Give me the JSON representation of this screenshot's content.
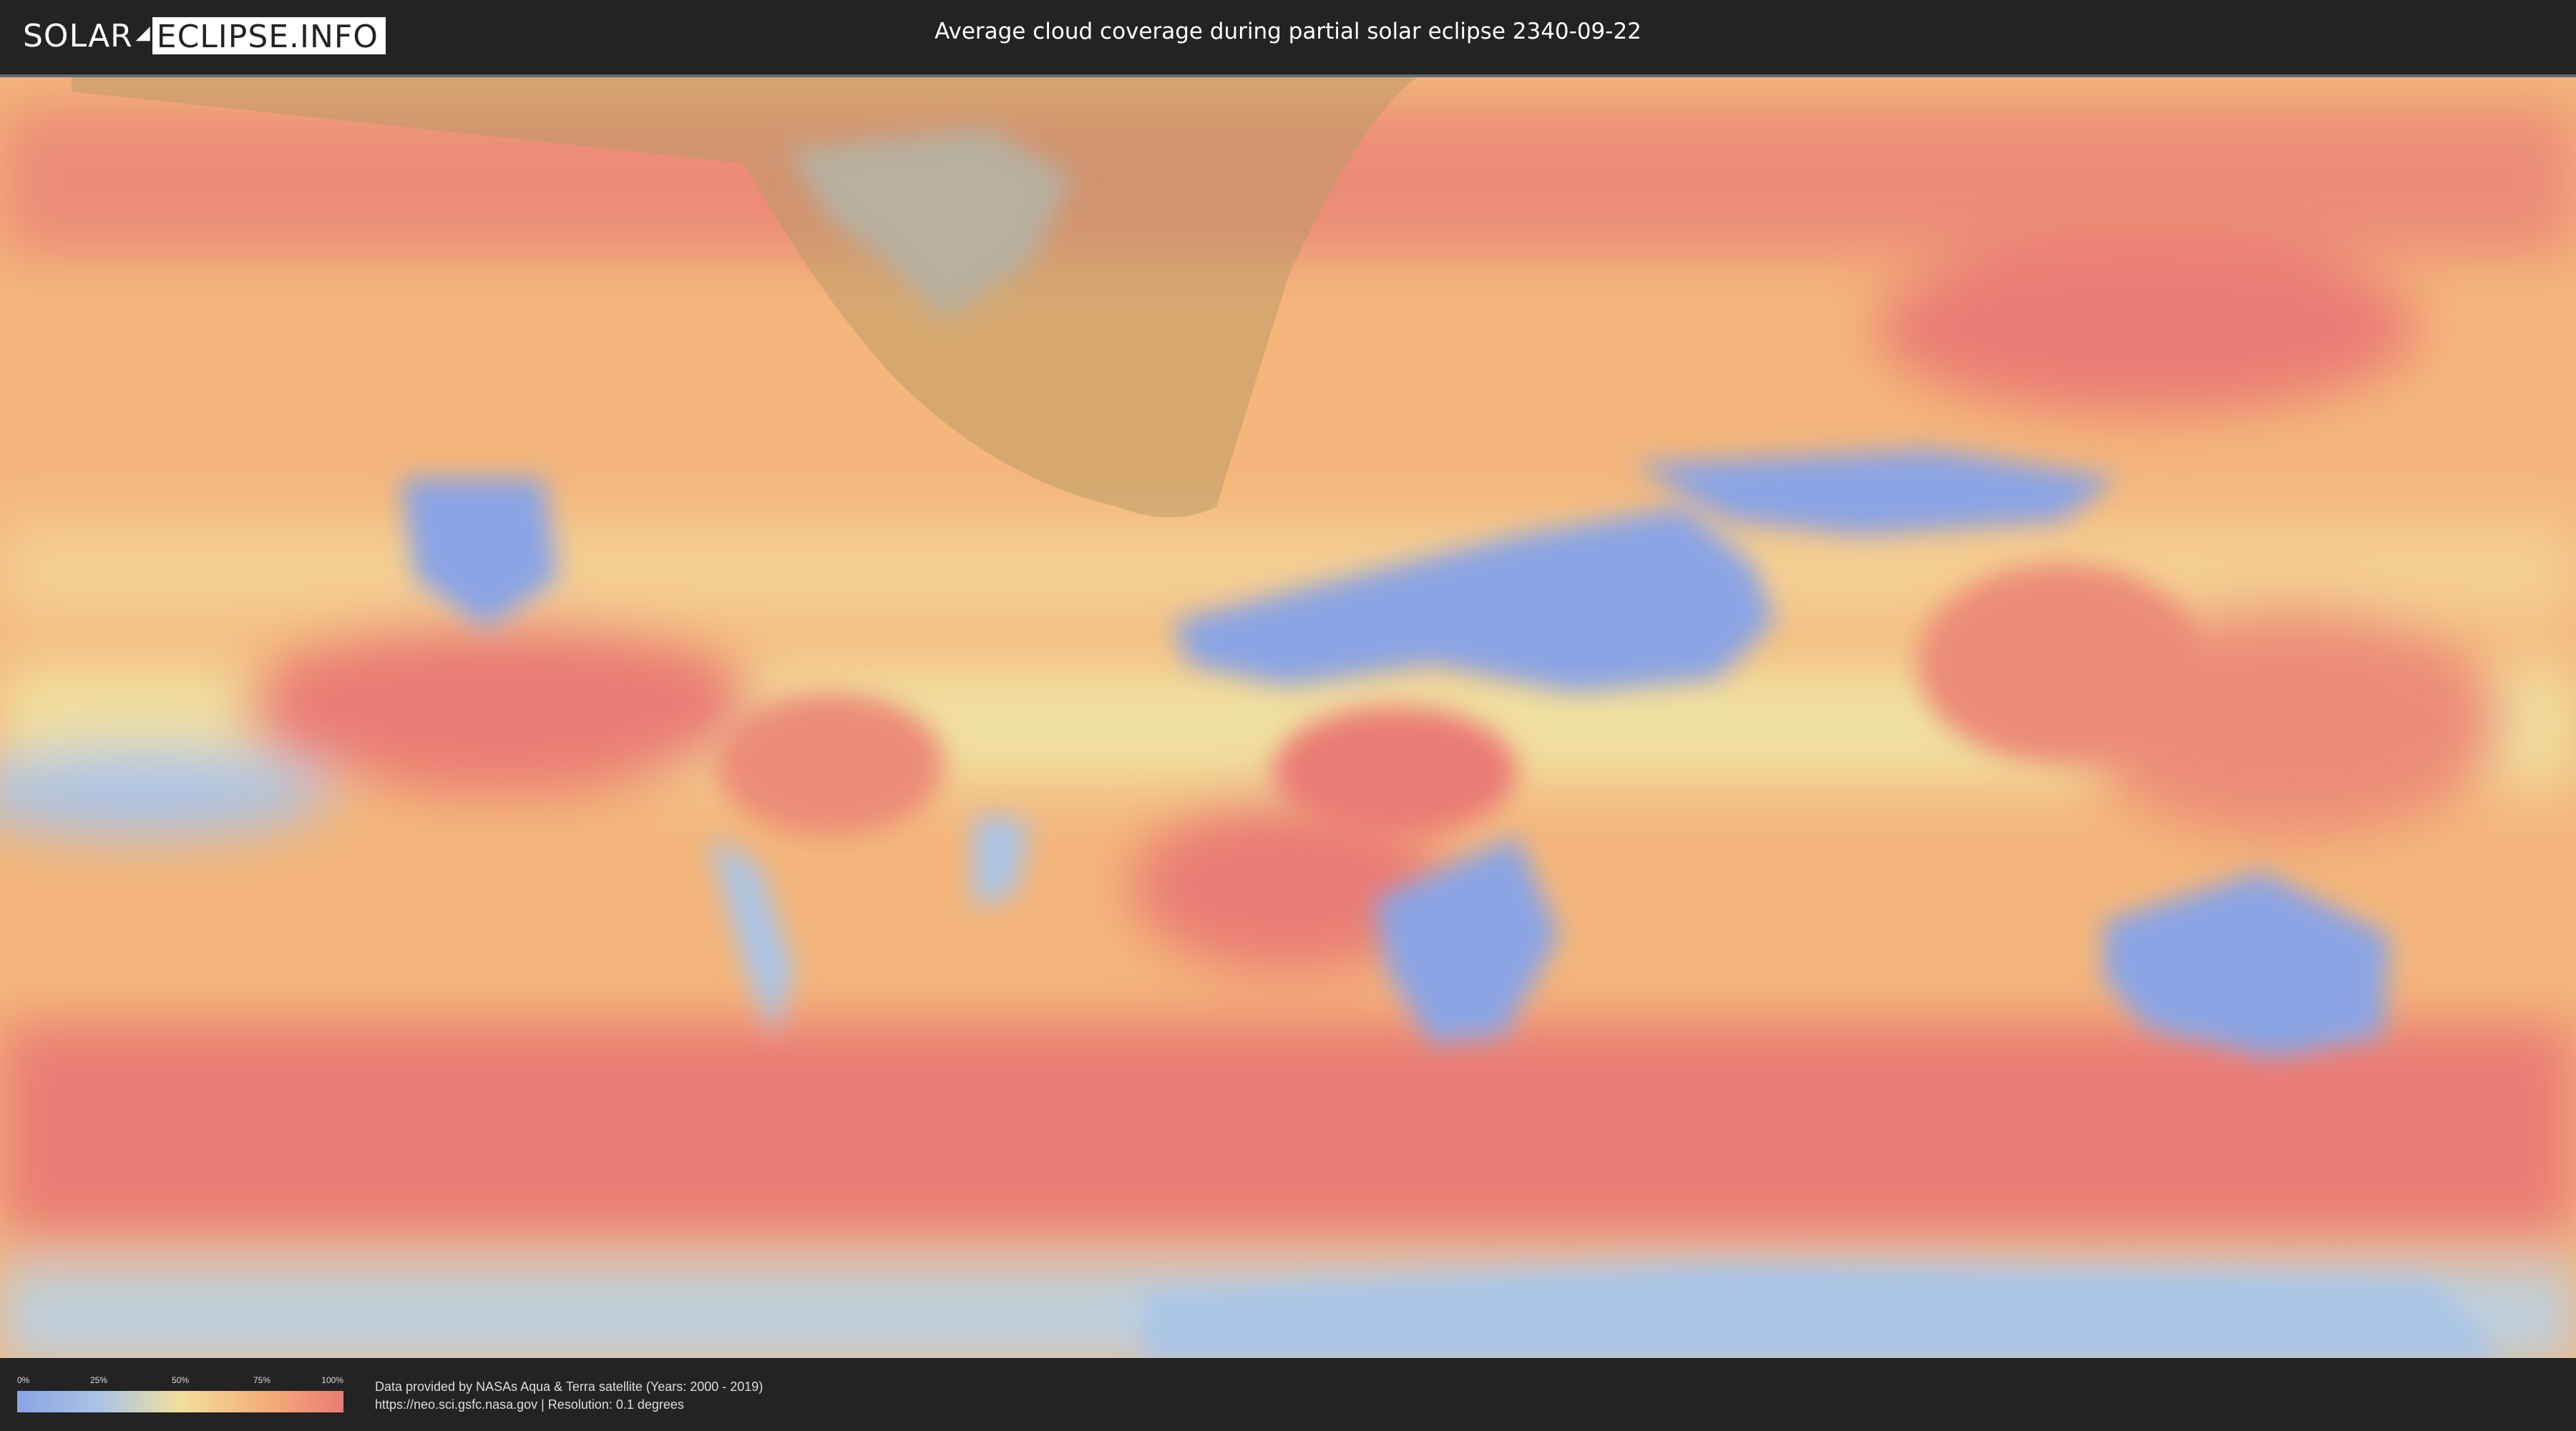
{
  "header": {
    "logo_left": "SOLAR",
    "logo_right": "ECLIPSE.INFO",
    "title": "Average cloud coverage during partial solar eclipse 2340-09-22"
  },
  "map": {
    "colors": {
      "clear": "#8aa4e4",
      "light": "#a9c4e6",
      "medium": "#f1df9c",
      "heavy": "#f5b077",
      "overcast": "#ea7c76",
      "eclipse_zone": "#b89a66"
    }
  },
  "legend": {
    "ticks": [
      "0%",
      "25%",
      "50%",
      "75%",
      "100%"
    ]
  },
  "footer": {
    "credit_line1": "Data provided by NASAs Aqua & Terra satellite (Years: 2000 - 2019)",
    "credit_line2": "https://neo.sci.gsfc.nasa.gov | Resolution: 0.1 degrees"
  }
}
